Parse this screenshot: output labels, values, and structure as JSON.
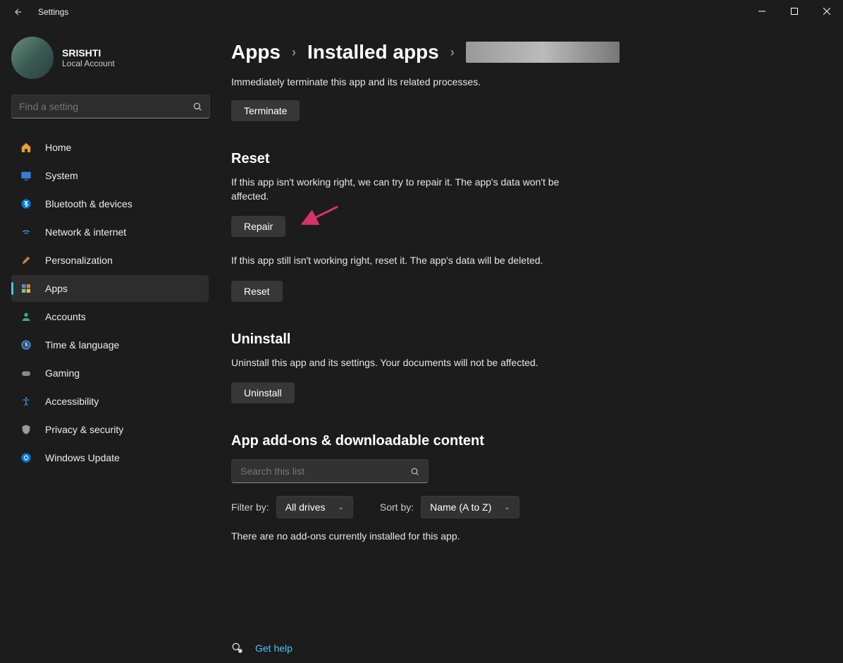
{
  "window": {
    "title": "Settings"
  },
  "profile": {
    "name": "SRISHTI",
    "sub": "Local Account"
  },
  "search": {
    "placeholder": "Find a setting"
  },
  "nav": {
    "home": "Home",
    "system": "System",
    "bluetooth": "Bluetooth & devices",
    "network": "Network & internet",
    "personalization": "Personalization",
    "apps": "Apps",
    "accounts": "Accounts",
    "time": "Time & language",
    "gaming": "Gaming",
    "accessibility": "Accessibility",
    "privacy": "Privacy & security",
    "update": "Windows Update"
  },
  "breadcrumb": {
    "apps": "Apps",
    "installed": "Installed apps"
  },
  "terminate": {
    "desc": "Immediately terminate this app and its related processes.",
    "btn": "Terminate"
  },
  "reset": {
    "title": "Reset",
    "repair_desc": "If this app isn't working right, we can try to repair it. The app's data won't be affected.",
    "repair_btn": "Repair",
    "reset_desc": "If this app still isn't working right, reset it. The app's data will be deleted.",
    "reset_btn": "Reset"
  },
  "uninstall": {
    "title": "Uninstall",
    "desc": "Uninstall this app and its settings. Your documents will not be affected.",
    "btn": "Uninstall"
  },
  "addons": {
    "title": "App add-ons & downloadable content",
    "search_placeholder": "Search this list",
    "filter_label": "Filter by:",
    "filter_value": "All drives",
    "sort_label": "Sort by:",
    "sort_value": "Name (A to Z)",
    "empty": "There are no add-ons currently installed for this app."
  },
  "help": {
    "label": "Get help"
  }
}
